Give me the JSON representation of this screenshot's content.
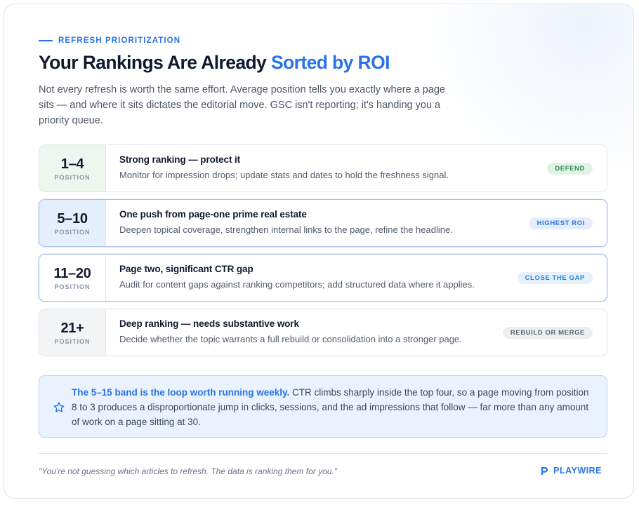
{
  "header": {
    "eyebrow": "REFRESH PRIORITIZATION",
    "title_plain": "Your Rankings Are Already ",
    "title_accent": "Sorted by ROI",
    "intro": "Not every refresh is worth the same effort. Average position tells you exactly where a page sits — and where it sits dictates the editorial move. GSC isn't reporting; it's handing you a priority queue."
  },
  "tiers": [
    {
      "range": "1–4",
      "position_label": "POSITION",
      "title": "Strong ranking — protect it",
      "desc": "Monitor for impression drops; update stats and dates to hold the freshness signal.",
      "badge": "DEFEND",
      "pos_bg": "#eef6ef",
      "badge_bg": "#e2f3e6",
      "badge_color": "#2e8b4f",
      "highlight": false
    },
    {
      "range": "5–10",
      "position_label": "POSITION",
      "title": "One push from page-one prime real estate",
      "desc": "Deepen topical coverage, strengthen internal links to the page, refine the headline.",
      "badge": "HIGHEST ROI",
      "pos_bg": "#e5eefb",
      "badge_bg": "#e3edfb",
      "badge_color": "#2a72e5",
      "highlight": true
    },
    {
      "range": "11–20",
      "position_label": "POSITION",
      "title": "Page two, significant CTR gap",
      "desc": "Audit for content gaps against ranking competitors; add structured data where it applies.",
      "badge": "CLOSE THE GAP",
      "pos_bg": "#ffffff",
      "badge_bg": "#e6f1fc",
      "badge_color": "#1f8ad6",
      "highlight": true
    },
    {
      "range": "21+",
      "position_label": "POSITION",
      "title": "Deep ranking — needs substantive work",
      "desc": "Decide whether the topic warrants a full rebuild or consolidation into a stronger page.",
      "badge": "REBUILD OR MERGE",
      "pos_bg": "#f3f4f6",
      "badge_bg": "#eceef1",
      "badge_color": "#5b6472",
      "highlight": false
    }
  ],
  "callout": {
    "icon": "star-icon",
    "lead": "The 5–15 band is the loop worth running weekly.",
    "body": " CTR climbs sharply inside the top four, so a page moving from position 8 to 3 produces a disproportionate jump in clicks, sessions, and the ad impressions that follow — far more than any amount of work on a page sitting at 30."
  },
  "footer": {
    "quote": "\"You're not guessing which articles to refresh. The data is ranking them for you.\"",
    "brand_icon": "playwire-logo-icon",
    "brand": "PLAYWIRE"
  },
  "colors": {
    "accent": "#2a72e5",
    "text": "#0f1a2e",
    "muted": "#505a6b"
  }
}
